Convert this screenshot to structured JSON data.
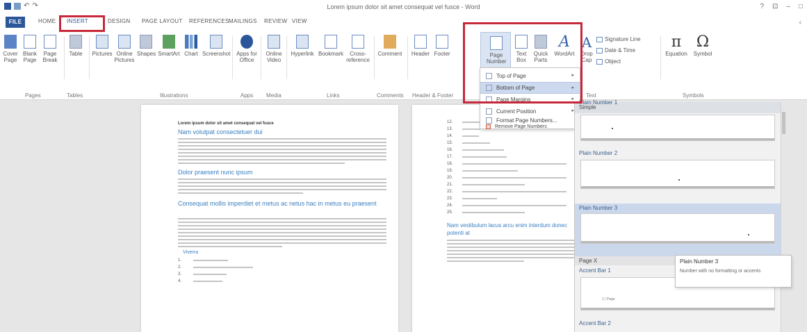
{
  "window": {
    "title": "Lorem ipsum dolor sit amet consequat vel fusce - Word",
    "qat_undo": "↶",
    "qat_redo": "↷",
    "controls": [
      "?",
      "⊡",
      "–",
      "□"
    ],
    "login": "‹"
  },
  "tabs": [
    "FILE",
    "HOME",
    "INSERT",
    "DESIGN",
    "PAGE LAYOUT",
    "REFERENCES",
    "MAILINGS",
    "REVIEW",
    "VIEW"
  ],
  "ribbon": {
    "pages": {
      "cover": "Cover\nPage",
      "blank": "Blank\nPage",
      "page_break": "Page\nBreak",
      "group": "Pages"
    },
    "tables": {
      "table": "Table",
      "group": "Tables"
    },
    "illustrations": {
      "pictures": "Pictures",
      "online_pictures": "Online\nPictures",
      "shapes": "Shapes",
      "smartart": "SmartArt",
      "chart": "Chart",
      "screenshot": "Screenshot",
      "group": "Illustrations"
    },
    "apps": {
      "apps_for_office": "Apps for\nOffice",
      "group": "Apps"
    },
    "media": {
      "online_video": "Online\nVideo",
      "group": "Media"
    },
    "links": {
      "hyperlink": "Hyperlink",
      "bookmark": "Bookmark",
      "cross_reference": "Cross-\nreference",
      "group": "Links"
    },
    "comments": {
      "comment": "Comment",
      "group": "Comments"
    },
    "header_footer": {
      "header": "Header",
      "footer": "Footer",
      "page_number": "Page\nNumber",
      "group": "Header & Footer"
    },
    "text": {
      "text_box": "Text\nBox",
      "quick_parts": "Quick\nParts",
      "wordart": "WordArt",
      "drop_cap": "Drop\nCap",
      "signature_line": "Signature Line",
      "date_time": "Date & Time",
      "object": "Object",
      "group": "Text"
    },
    "symbols": {
      "equation": "Equation",
      "symbol": "Symbol",
      "equation_glyph": "π",
      "symbol_glyph": "Ω",
      "group": "Symbols"
    }
  },
  "page_number_menu": {
    "items": [
      {
        "label": "Top of Page",
        "has_submenu": true
      },
      {
        "label": "Bottom of Page",
        "has_submenu": true,
        "active": true
      },
      {
        "label": "Page Margins",
        "has_submenu": true
      },
      {
        "label": "Current Position",
        "has_submenu": true
      },
      {
        "label": "Format Page Numbers...",
        "has_submenu": false
      },
      {
        "label": "Remove Page Numbers",
        "has_submenu": false
      }
    ]
  },
  "gallery": {
    "header": "Simple",
    "plain1": "Plain Number 1",
    "plain2": "Plain Number 2",
    "plain3": "Plain Number 3",
    "section": "Page X",
    "accent1": "Accent Bar 1",
    "accent1_text": "1 | Page",
    "accent2": "Accent Bar 2"
  },
  "tooltip": {
    "title": "Plain Number 3",
    "description": "Number with no formatting or accents"
  },
  "document": {
    "page1": {
      "title": "Lorem ipsum dolor sit amet consequat vel fusce",
      "heading1": "Nam volutpat consectetuer dui",
      "heading2": "Dolor praesent nunc ipsum",
      "heading3": "Consequat mollis imperdiet et metus ac netus hac in metus eu praesent",
      "subheading": "Viverra",
      "list_numbers": [
        "1.",
        "2.",
        "3.",
        "4."
      ]
    },
    "page2": {
      "list_numbers": [
        "12.",
        "13.",
        "14.",
        "15.",
        "16.",
        "17.",
        "18.",
        "19.",
        "20.",
        "21.",
        "22.",
        "23.",
        "24.",
        "25."
      ],
      "heading": "Nam vestibulum lacus arcu enim interdum donec potenti at"
    }
  },
  "colors": {
    "accent": "#2b579a",
    "highlight": "#c6283a",
    "heading_blue": "#3a7fbf"
  }
}
